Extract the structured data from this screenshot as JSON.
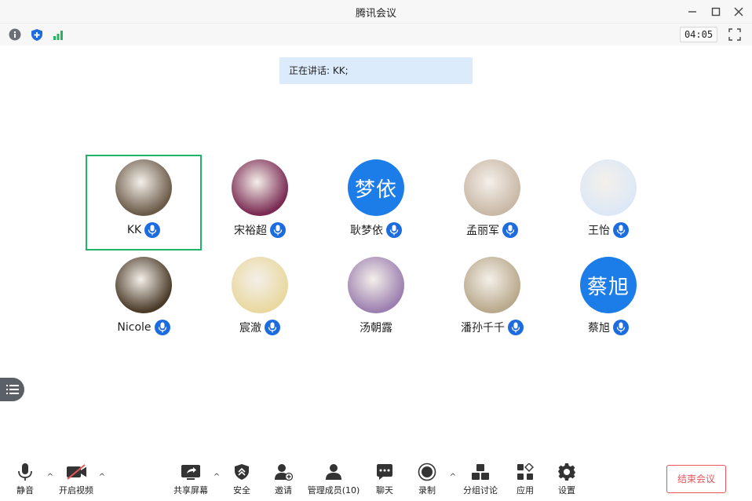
{
  "window": {
    "title": "腾讯会议"
  },
  "status": {
    "timer": "04:05"
  },
  "speaking": {
    "text": "正在讲话: KK;"
  },
  "participants": [
    {
      "name": "KK",
      "active": true,
      "host": true,
      "avatar_type": "photo",
      "avatar_color": "#6b5a48"
    },
    {
      "name": "宋裕超",
      "active": false,
      "host": false,
      "avatar_type": "photo",
      "avatar_color": "#7a2a52"
    },
    {
      "name": "耿梦依",
      "active": false,
      "host": false,
      "avatar_type": "text",
      "avatar_text": "梦依",
      "avatar_color": "#1c7ce8"
    },
    {
      "name": "孟丽军",
      "active": false,
      "host": false,
      "avatar_type": "photo",
      "avatar_color": "#c9b8a6"
    },
    {
      "name": "王怡",
      "active": false,
      "host": false,
      "avatar_type": "photo",
      "avatar_color": "#dde8f6"
    },
    {
      "name": "Nicole",
      "active": false,
      "host": false,
      "avatar_type": "photo",
      "avatar_color": "#4a3a28"
    },
    {
      "name": "宸澈",
      "active": false,
      "host": false,
      "avatar_type": "photo",
      "avatar_color": "#e9d8a0"
    },
    {
      "name": "汤朝露",
      "active": false,
      "host": false,
      "mic": false,
      "avatar_type": "photo",
      "avatar_color": "#9c7fb0"
    },
    {
      "name": "潘孙千千",
      "active": false,
      "host": false,
      "avatar_type": "photo",
      "avatar_color": "#b9a98c"
    },
    {
      "name": "蔡旭",
      "active": false,
      "host": false,
      "avatar_type": "text",
      "avatar_text": "蔡旭",
      "avatar_color": "#1c7ce8"
    }
  ],
  "toolbar": {
    "mute": "静音",
    "video": "开启视频",
    "share": "共享屏幕",
    "security": "安全",
    "invite": "邀请",
    "members": "管理成员(10)",
    "chat": "聊天",
    "record": "录制",
    "breakout": "分组讨论",
    "apps": "应用",
    "settings": "设置",
    "end": "结束会议"
  },
  "colors": {
    "accent": "#1c6ce0",
    "active_border": "#1fb26b",
    "end": "#e8555a"
  }
}
